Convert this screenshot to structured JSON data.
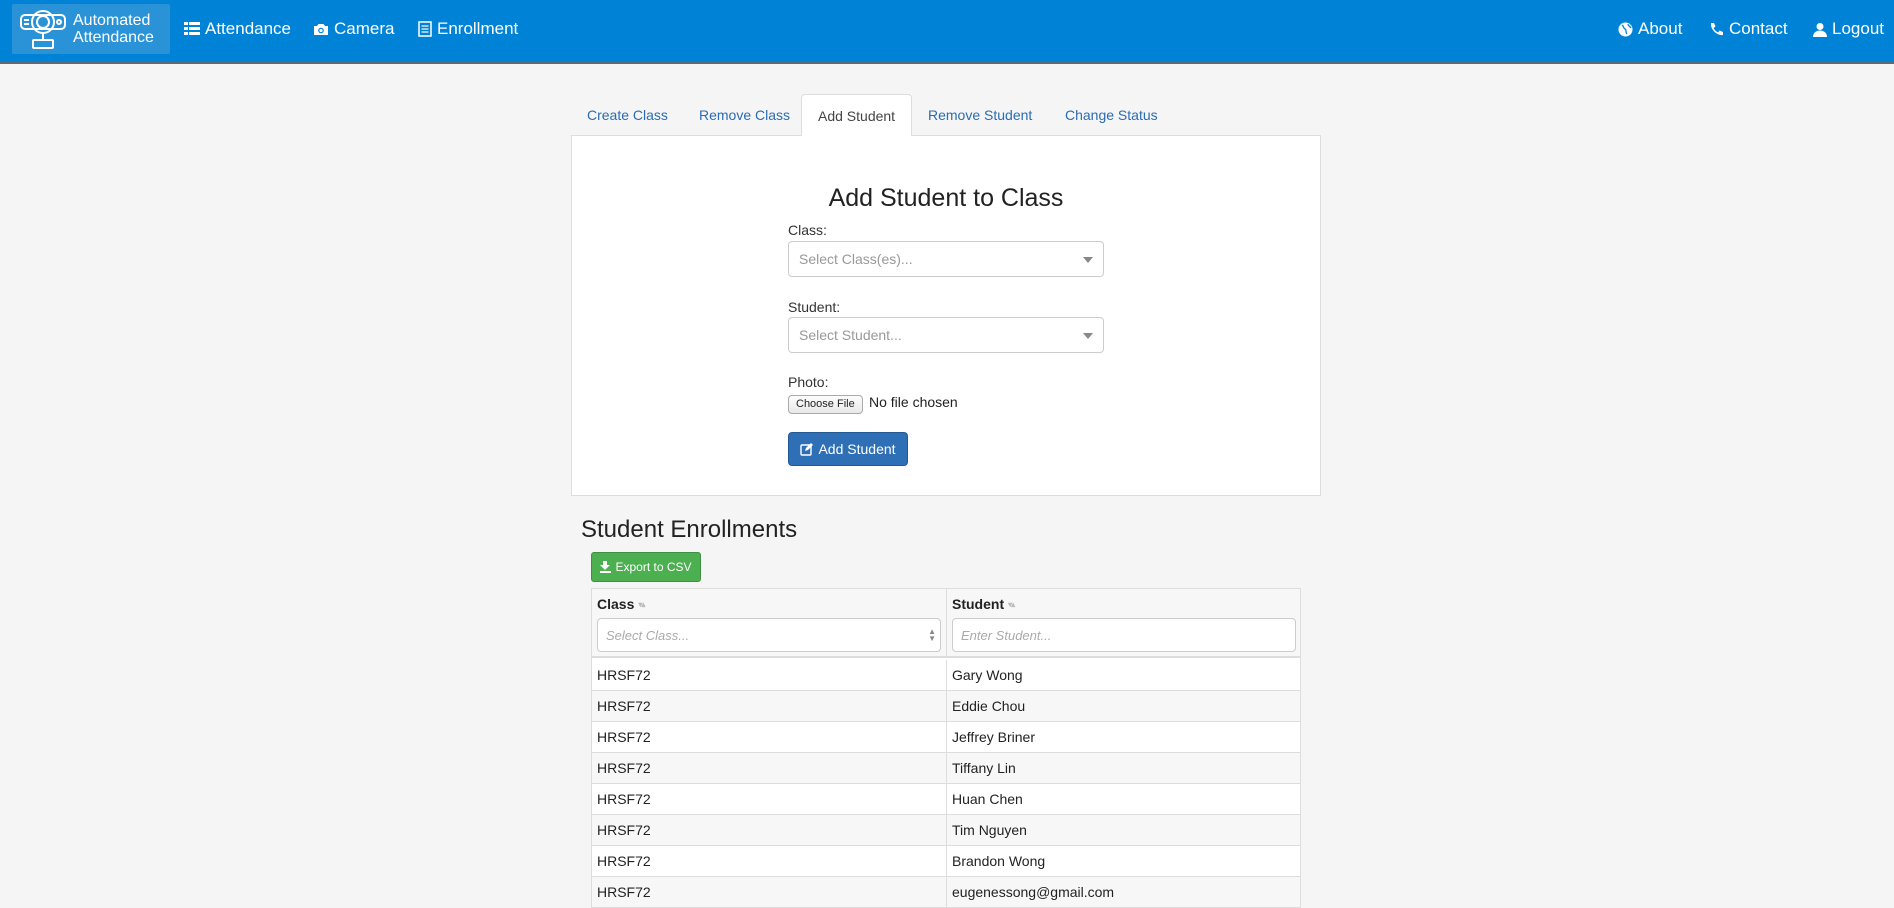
{
  "navbar": {
    "brand_line1": "Automated",
    "brand_line2": "Attendance",
    "left_links": [
      {
        "label": "Attendance",
        "icon": "list-icon"
      },
      {
        "label": "Camera",
        "icon": "camera-icon"
      },
      {
        "label": "Enrollment",
        "icon": "document-icon"
      }
    ],
    "right_links": [
      {
        "label": "About",
        "icon": "globe-icon"
      },
      {
        "label": "Contact",
        "icon": "phone-icon"
      },
      {
        "label": "Logout",
        "icon": "user-icon"
      }
    ],
    "color": "#0083d6"
  },
  "tabs": [
    {
      "label": "Create Class",
      "active": false
    },
    {
      "label": "Remove Class",
      "active": false
    },
    {
      "label": "Add Student",
      "active": true
    },
    {
      "label": "Remove Student",
      "active": false
    },
    {
      "label": "Change Status",
      "active": false
    }
  ],
  "form": {
    "title": "Add Student to Class",
    "class_label": "Class:",
    "class_placeholder": "Select Class(es)...",
    "student_label": "Student:",
    "student_placeholder": "Select Student...",
    "photo_label": "Photo:",
    "file_button": "Choose File",
    "file_status": "No file chosen",
    "submit_label": "Add Student"
  },
  "enrollments": {
    "title": "Student Enrollments",
    "export_label": "Export to CSV",
    "columns": [
      "Class",
      "Student"
    ],
    "class_filter_placeholder": "Select Class...",
    "student_filter_placeholder": "Enter Student...",
    "rows": [
      {
        "class": "HRSF72",
        "student": "Gary Wong"
      },
      {
        "class": "HRSF72",
        "student": "Eddie Chou"
      },
      {
        "class": "HRSF72",
        "student": "Jeffrey Briner"
      },
      {
        "class": "HRSF72",
        "student": "Tiffany Lin"
      },
      {
        "class": "HRSF72",
        "student": "Huan Chen"
      },
      {
        "class": "HRSF72",
        "student": "Tim Nguyen"
      },
      {
        "class": "HRSF72",
        "student": "Brandon Wong"
      },
      {
        "class": "HRSF72",
        "student": "eugenessong@gmail.com"
      }
    ]
  }
}
